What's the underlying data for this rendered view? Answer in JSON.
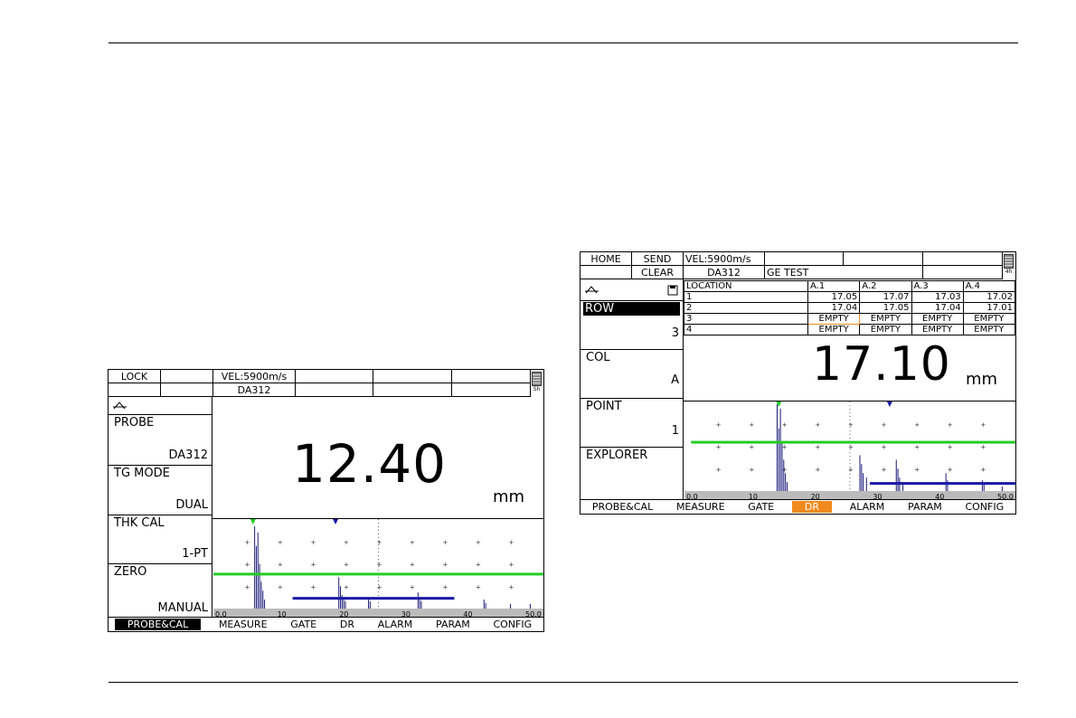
{
  "left_screen": {
    "status": {
      "row1": [
        "LOCK",
        "",
        "VEL:5900m/s",
        "",
        "",
        ""
      ],
      "row2": [
        "",
        "",
        "DA312",
        "",
        "",
        ""
      ]
    },
    "menu": [
      {
        "label": "PROBE",
        "value": "DA312"
      },
      {
        "label": "TG MODE",
        "value": "DUAL"
      },
      {
        "label": "THK CAL",
        "value": "1-PT"
      },
      {
        "label": "ZERO",
        "value": "MANUAL"
      }
    ],
    "reading": "12.40",
    "unit": "mm",
    "axis_labels": [
      "0.0",
      "10",
      "20",
      "30",
      "40",
      "50.0"
    ],
    "tabs": [
      "PROBE&CAL",
      "MEASURE",
      "GATE",
      "DR",
      "ALARM",
      "PARAM",
      "CONFIG"
    ],
    "active_tab": "PROBE&CAL"
  },
  "right_screen": {
    "status": {
      "row1": [
        "HOME",
        "SEND",
        "VEL:5900m/s",
        "",
        "",
        ""
      ],
      "row2": [
        "",
        "CLEAR",
        "DA312",
        "GE TEST",
        "",
        ""
      ]
    },
    "menu": [
      {
        "label": "ROW",
        "value": "3",
        "selected": true
      },
      {
        "label": "COL",
        "value": "A"
      },
      {
        "label": "POINT",
        "value": "1"
      },
      {
        "label": "EXPLORER",
        "value": ""
      }
    ],
    "table": {
      "headers": [
        "LOCATION",
        "A.1",
        "A.2",
        "A.3",
        "A.4"
      ],
      "rows": [
        [
          "1",
          "17.05",
          "17.07",
          "17.03",
          "17.02"
        ],
        [
          "2",
          "17.04",
          "17.05",
          "17.04",
          "17.01"
        ],
        [
          "3",
          "EMPTY",
          "EMPTY",
          "EMPTY",
          "EMPTY"
        ],
        [
          "4",
          "EMPTY",
          "EMPTY",
          "EMPTY",
          "EMPTY"
        ]
      ]
    },
    "reading": "17.10",
    "unit": "mm",
    "axis_labels": [
      "0.0",
      "10",
      "20",
      "30",
      "40",
      "50.0"
    ],
    "tabs": [
      "PROBE&CAL",
      "MEASURE",
      "GATE",
      "DR",
      "ALARM",
      "PARAM",
      "CONFIG"
    ],
    "active_tab": "DR"
  },
  "colors": {
    "gate_a": "#22cc22",
    "gate_b": "#1a1aa8",
    "signal": "#1a1a7a",
    "active_orange": "#f08a1c"
  },
  "icons": {
    "battery": "battery-icon",
    "waveform": "rectify-icon",
    "save": "save-icon",
    "lock": "lock-icon"
  }
}
